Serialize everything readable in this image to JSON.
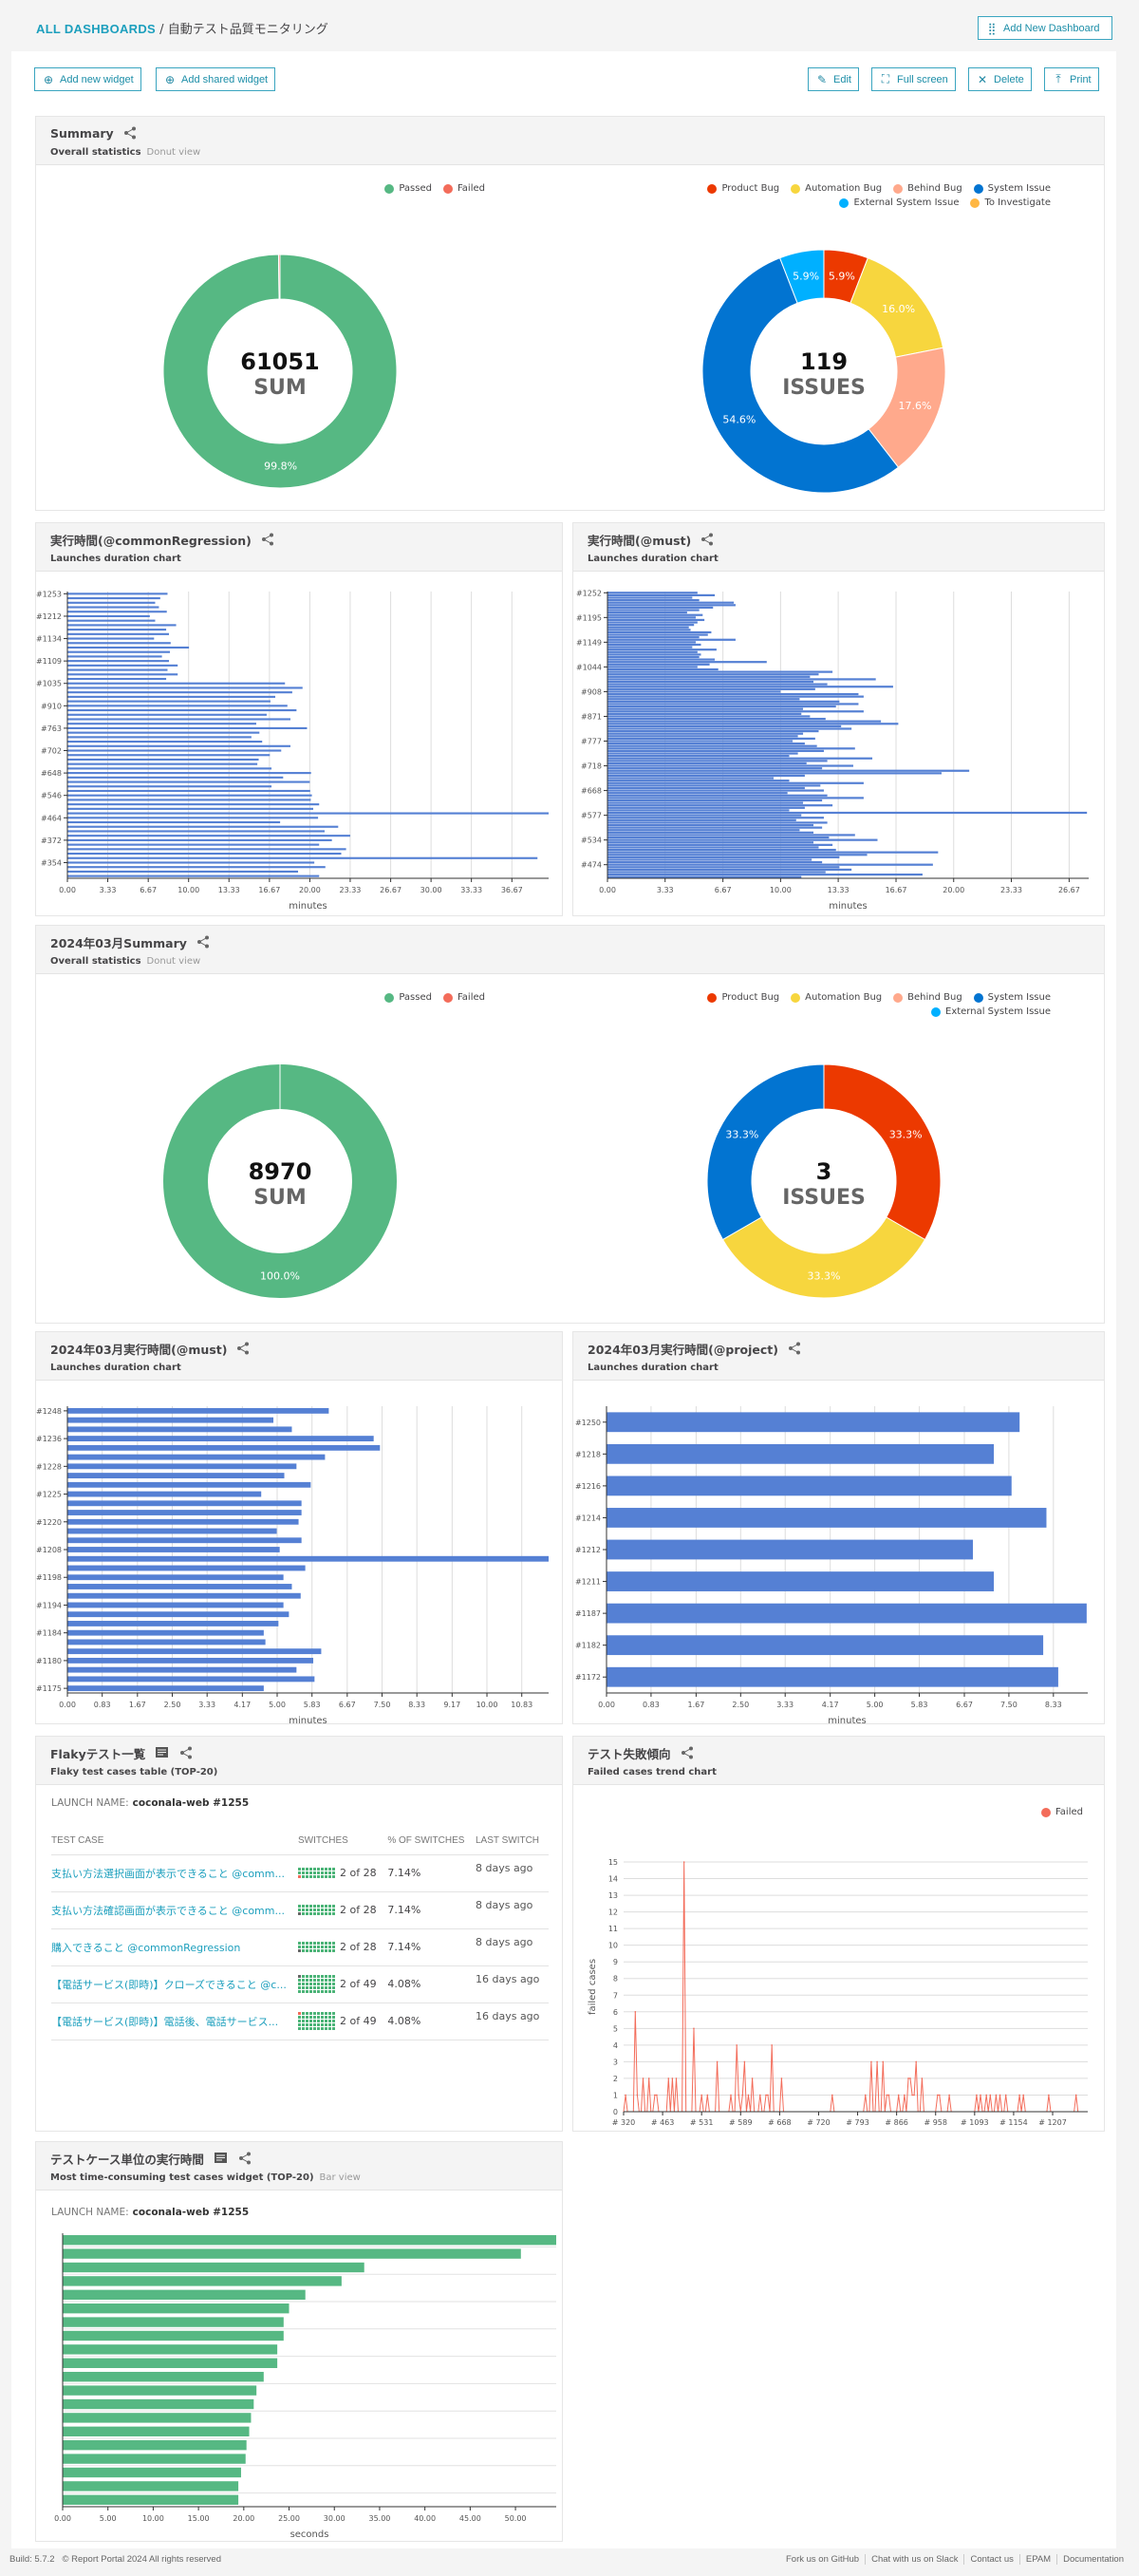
{
  "header": {
    "breadcrumb_root": "ALL DASHBOARDS",
    "breadcrumb_sep": "/",
    "dashboard_name": "自動テスト品質モニタリング",
    "add_dashboard_label": "Add New Dashboard"
  },
  "toolbar": {
    "add_widget": "Add new widget",
    "add_shared": "Add shared widget",
    "edit": "Edit",
    "full_screen": "Full screen",
    "delete": "Delete",
    "print": "Print"
  },
  "colors": {
    "passed": "#56b883",
    "failed": "#f36c5a",
    "product_bug": "#ec3900",
    "automation_bug": "#f7d63e",
    "behind_bug": "#ffa98c",
    "system_issue": "#0274d1",
    "external_system_issue": "#00b0ff",
    "to_investigate": "#ffb743",
    "bar": "#5580d4",
    "link": "#1c9fbd"
  },
  "widgets": {
    "summary": {
      "title": "Summary",
      "type": "Overall statistics",
      "view": "Donut view",
      "legend_launch": [
        "Passed",
        "Failed"
      ],
      "legend_issues": [
        "Product Bug",
        "Automation Bug",
        "Behind Bug",
        "System Issue",
        "External System Issue",
        "To Investigate"
      ]
    },
    "dur_common": {
      "title": "実行時間(@commonRegression)",
      "type": "Launches duration chart"
    },
    "dur_must": {
      "title": "実行時間(@must)",
      "type": "Launches duration chart"
    },
    "summary_march": {
      "title": "2024年03月Summary",
      "type": "Overall statistics",
      "view": "Donut view",
      "legend_launch": [
        "Passed",
        "Failed"
      ],
      "legend_issues": [
        "Product Bug",
        "Automation Bug",
        "Behind Bug",
        "System Issue",
        "External System Issue"
      ]
    },
    "dur_march_must": {
      "title": "2024年03月実行時間(@must)",
      "type": "Launches duration chart"
    },
    "dur_march_project": {
      "title": "2024年03月実行時間(@project)",
      "type": "Launches duration chart"
    },
    "flaky": {
      "title": "Flakyテスト一覧",
      "type": "Flaky test cases table (TOP-20)",
      "launch_label": "LAUNCH NAME:",
      "launch_name": "coconala-web #1255",
      "columns": [
        "TEST CASE",
        "SWITCHES",
        "% OF SWITCHES",
        "LAST SWITCH"
      ],
      "rows": [
        {
          "name": "支払い方法選択画面が表示できること @comm...",
          "switches": "2 of 28",
          "total": 28,
          "marker": "red",
          "percent": "7.14%",
          "last": "8 days ago"
        },
        {
          "name": "支払い方法確認画面が表示できること @comm...",
          "switches": "2 of 28",
          "total": 28,
          "marker": "gray",
          "percent": "7.14%",
          "last": "8 days ago"
        },
        {
          "name": "購入できること @commonRegression",
          "switches": "2 of 28",
          "total": 28,
          "marker": "gray",
          "percent": "7.14%",
          "last": "8 days ago"
        },
        {
          "name": "【電話サービス(即時)】クローズできること @c...",
          "switches": "2 of 49",
          "total": 49,
          "marker": "gray",
          "percent": "4.08%",
          "last": "16 days ago"
        },
        {
          "name": "【電話サービス(即時)】電話後、電話サービス...",
          "switches": "2 of 49",
          "total": 49,
          "marker": "red",
          "percent": "4.08%",
          "last": "16 days ago"
        }
      ]
    },
    "trend": {
      "title": "テスト失敗傾向",
      "type": "Failed cases trend chart"
    },
    "most_time": {
      "title": "テストケース単位の実行時間",
      "type": "Most time-consuming test cases widget (TOP-20)",
      "view": "Bar view",
      "launch_label": "LAUNCH NAME:",
      "launch_name": "coconala-web #1255"
    }
  },
  "chart_data": [
    {
      "id": "summary_launch",
      "type": "pie",
      "center_value": "61051",
      "center_label": "SUM",
      "slices": [
        {
          "name": "Passed",
          "value": 99.8,
          "label": "99.8%"
        },
        {
          "name": "Failed",
          "value": 0.2,
          "label": ""
        }
      ]
    },
    {
      "id": "summary_issues",
      "type": "pie",
      "center_value": "119",
      "center_label": "ISSUES",
      "slices": [
        {
          "name": "Product Bug",
          "value": 5.9,
          "label": "5.9%"
        },
        {
          "name": "Automation Bug",
          "value": 16.0,
          "label": "16.0%"
        },
        {
          "name": "Behind Bug",
          "value": 17.6,
          "label": "17.6%"
        },
        {
          "name": "System Issue",
          "value": 54.6,
          "label": "54.6%"
        },
        {
          "name": "External System Issue",
          "value": 5.9,
          "label": "5.9%"
        }
      ]
    },
    {
      "id": "dur_common",
      "type": "bar",
      "orientation": "horizontal",
      "xlabel": "minutes",
      "xlim": [
        0,
        39.7
      ],
      "x_ticks": [
        "0.00",
        "3.33",
        "6.67",
        "10.00",
        "13.33",
        "16.67",
        "20.00",
        "23.33",
        "26.67",
        "30.00",
        "33.33",
        "36.67"
      ],
      "y_tick_labels": [
        "#1253",
        "#1212",
        "#1134",
        "#1109",
        "#1035",
        "#910",
        "#763",
        "#702",
        "#648",
        "#546",
        "#464",
        "#372",
        "#354"
      ],
      "label_every": 5,
      "values": [
        8.26,
        7.66,
        7.24,
        7.55,
        8.2,
        6.8,
        7.24,
        8.97,
        8.15,
        8.38,
        7.15,
        8.52,
        10.03,
        8.46,
        7.8,
        8.38,
        9.1,
        8.26,
        9.1,
        8.15,
        17.95,
        19.4,
        18.55,
        17.15,
        16.75,
        18.15,
        18.9,
        16.44,
        18.4,
        15.58,
        19.77,
        15.84,
        15.18,
        16.07,
        18.4,
        17.64,
        16.7,
        15.78,
        15.67,
        16.84,
        20.1,
        17.8,
        20.0,
        16.84,
        20.03,
        20.17,
        20.08,
        20.77,
        20.28,
        39.7,
        20.68,
        17.55,
        22.34,
        21.22,
        23.33,
        21.82,
        20.77,
        22.99,
        22.59,
        38.78,
        20.37,
        21.28,
        19.03,
        20.77
      ]
    },
    {
      "id": "dur_must",
      "type": "bar",
      "orientation": "horizontal",
      "xlabel": "minutes",
      "xlim": [
        0,
        27.8
      ],
      "x_ticks": [
        "0.00",
        "3.33",
        "6.67",
        "10.00",
        "13.33",
        "16.67",
        "20.00",
        "23.33",
        "26.67"
      ],
      "y_tick_labels": [
        "#1252",
        "#1195",
        "#1149",
        "#1044",
        "#908",
        "#871",
        "#777",
        "#718",
        "#668",
        "#577",
        "#534",
        "#474"
      ],
      "label_every": 10,
      "values": [
        5.2,
        6.2,
        4.9,
        5.3,
        7.3,
        7.4,
        6.1,
        5.3,
        4.6,
        5.5,
        5.1,
        5.6,
        5.2,
        5.0,
        4.7,
        4.8,
        6.0,
        5.8,
        5.3,
        7.4,
        5.1,
        5.4,
        4.9,
        6.3,
        5.2,
        5.4,
        5.3,
        6.2,
        9.2,
        5.9,
        5.2,
        6.4,
        13.0,
        12.2,
        11.7,
        15.5,
        11.9,
        12.7,
        16.5,
        12.0,
        10.0,
        14.5,
        14.8,
        11.1,
        13.4,
        14.5,
        13.2,
        11.3,
        14.8,
        11.2,
        11.7,
        12.6,
        15.8,
        16.8,
        13.5,
        14.1,
        12.2,
        11.3,
        11.0,
        12.0,
        10.7,
        11.4,
        12.1,
        14.3,
        12.5,
        11.0,
        10.5,
        15.3,
        12.7,
        11.5,
        14.2,
        12.4,
        20.9,
        19.3,
        11.4,
        9.6,
        10.5,
        14.8,
        12.3,
        11.4,
        12.5,
        10.4,
        12.7,
        14.8,
        12.4,
        11.3,
        13.0,
        11.4,
        10.5,
        27.7,
        11.2,
        12.5,
        10.9,
        12.7,
        11.9,
        12.4,
        11.1,
        11.9,
        14.3,
        12.8,
        15.6,
        11.9,
        13.0,
        12.2,
        13.2,
        19.1,
        15.0,
        13.4,
        11.8,
        12.4,
        18.8,
        13.4,
        14.1,
        12.6,
        18.2,
        11.2
      ]
    },
    {
      "id": "summary_march_launch",
      "type": "pie",
      "center_value": "8970",
      "center_label": "SUM",
      "slices": [
        {
          "name": "Passed",
          "value": 100.0,
          "label": "100.0%"
        }
      ]
    },
    {
      "id": "summary_march_issues",
      "type": "pie",
      "center_value": "3",
      "center_label": "ISSUES",
      "slices": [
        {
          "name": "Product Bug",
          "value": 33.3,
          "label": "33.3%"
        },
        {
          "name": "Automation Bug",
          "value": 33.3,
          "label": "33.3%"
        },
        {
          "name": "System Issue",
          "value": 33.3,
          "label": "33.3%"
        }
      ]
    },
    {
      "id": "dur_march_must",
      "type": "bar",
      "orientation": "horizontal",
      "xlabel": "minutes",
      "xlim": [
        0,
        11.47
      ],
      "x_ticks": [
        "0.00",
        "0.83",
        "1.67",
        "2.50",
        "3.33",
        "4.17",
        "5.00",
        "5.83",
        "6.67",
        "7.50",
        "8.33",
        "9.17",
        "10.00",
        "10.83"
      ],
      "y_tick_labels": [
        "#1248",
        "#1236",
        "#1228",
        "#1225",
        "#1220",
        "#1208",
        "#1198",
        "#1194",
        "#1184",
        "#1180",
        "#1175"
      ],
      "label_every": 3,
      "values": [
        6.23,
        4.91,
        5.35,
        7.3,
        7.45,
        6.14,
        5.46,
        5.17,
        5.8,
        4.62,
        5.58,
        5.58,
        5.51,
        4.99,
        5.58,
        5.06,
        11.47,
        5.67,
        5.15,
        5.35,
        5.56,
        5.15,
        5.28,
        5.03,
        4.68,
        4.72,
        6.05,
        5.86,
        5.46,
        5.89,
        4.68
      ]
    },
    {
      "id": "dur_march_project",
      "type": "bar",
      "orientation": "horizontal",
      "xlabel": "minutes",
      "xlim": [
        0,
        8.97
      ],
      "x_ticks": [
        "0.00",
        "0.83",
        "1.67",
        "2.50",
        "3.33",
        "4.17",
        "5.00",
        "5.83",
        "6.67",
        "7.50",
        "8.33"
      ],
      "y_tick_labels": [
        "#1250",
        "#1218",
        "#1216",
        "#1214",
        "#1212",
        "#1211",
        "#1187",
        "#1182",
        "#1172"
      ],
      "label_every": 1,
      "values": [
        7.7,
        7.22,
        7.55,
        8.2,
        6.83,
        7.22,
        8.95,
        8.14,
        8.42
      ]
    },
    {
      "id": "trend",
      "type": "line",
      "ylabel": "failed cases",
      "ylim": [
        0,
        15
      ],
      "legend": "top-right",
      "series": [
        {
          "name": "Failed"
        }
      ],
      "x_tick_labels": [
        "# 320",
        "# 463",
        "# 531",
        "# 589",
        "# 668",
        "# 720",
        "# 793",
        "# 866",
        "# 958",
        "# 1093",
        "# 1154",
        "# 1207"
      ],
      "label_every": 20,
      "values": [
        0,
        1,
        0,
        0,
        0,
        0,
        6,
        1,
        0,
        0,
        2,
        0,
        0,
        2,
        0,
        0,
        1,
        1,
        0,
        0,
        0,
        0,
        0,
        2,
        0,
        2,
        0,
        2,
        0,
        0,
        0,
        15,
        0,
        0,
        0,
        0,
        5,
        0,
        0,
        0,
        1,
        0,
        0,
        1,
        0,
        0,
        0,
        0,
        3,
        0,
        0,
        0,
        0,
        0,
        0,
        1,
        0,
        0,
        4,
        1,
        0,
        1,
        3,
        0,
        1,
        0,
        2,
        0,
        0,
        0,
        1,
        0,
        0,
        1,
        1,
        0,
        4,
        0,
        0,
        0,
        0,
        2,
        0,
        0,
        0,
        0,
        0,
        0,
        0,
        0,
        0,
        0,
        0,
        0,
        0,
        0,
        0,
        0,
        0,
        0,
        0,
        0,
        0,
        0,
        0,
        0,
        0,
        1,
        0,
        0,
        0,
        0,
        0,
        0,
        0,
        0,
        0,
        0,
        0,
        0,
        0,
        0,
        0,
        0,
        1,
        0,
        0,
        3,
        0,
        0,
        3,
        0,
        0,
        3,
        0,
        1,
        1,
        0,
        0,
        0,
        0,
        1,
        0,
        0,
        1,
        0,
        2,
        2,
        1,
        1,
        3,
        0,
        0,
        2,
        0,
        0,
        0,
        0,
        0,
        0,
        0,
        1,
        1,
        0,
        0,
        0,
        0,
        1,
        0,
        0,
        0,
        0,
        0,
        0,
        0,
        0,
        0,
        0,
        0,
        0,
        0,
        1,
        0,
        1,
        0,
        0,
        1,
        0,
        1,
        0,
        0,
        1,
        0,
        1,
        0,
        0,
        1,
        0,
        0,
        0,
        0,
        0,
        0,
        1,
        0,
        1,
        0,
        0,
        0,
        0,
        0,
        0,
        0,
        0,
        0,
        0,
        0,
        0,
        1,
        0,
        0,
        0,
        0,
        0,
        0,
        0,
        0,
        0,
        0,
        0,
        0,
        0,
        1,
        0,
        0,
        0,
        0,
        0,
        0
      ]
    },
    {
      "id": "most_time",
      "type": "bar",
      "orientation": "horizontal",
      "xlabel": "seconds",
      "xlim": [
        0,
        54.5
      ],
      "x_ticks": [
        "0.00",
        "5.00",
        "10.00",
        "15.00",
        "20.00",
        "25.00",
        "30.00",
        "35.00",
        "40.00",
        "45.00",
        "50.00"
      ],
      "values": [
        54.5,
        50.6,
        33.3,
        30.8,
        26.8,
        25.0,
        24.4,
        24.4,
        23.7,
        23.7,
        22.2,
        21.4,
        21.1,
        20.8,
        20.6,
        20.3,
        20.2,
        19.7,
        19.4,
        19.4
      ]
    }
  ],
  "footer": {
    "build": "Build: 5.7.2",
    "copyright": "© Report Portal 2024 All rights reserved",
    "links": [
      "Fork us on GitHub",
      "Chat with us on Slack",
      "Contact us",
      "EPAM",
      "Documentation"
    ]
  }
}
